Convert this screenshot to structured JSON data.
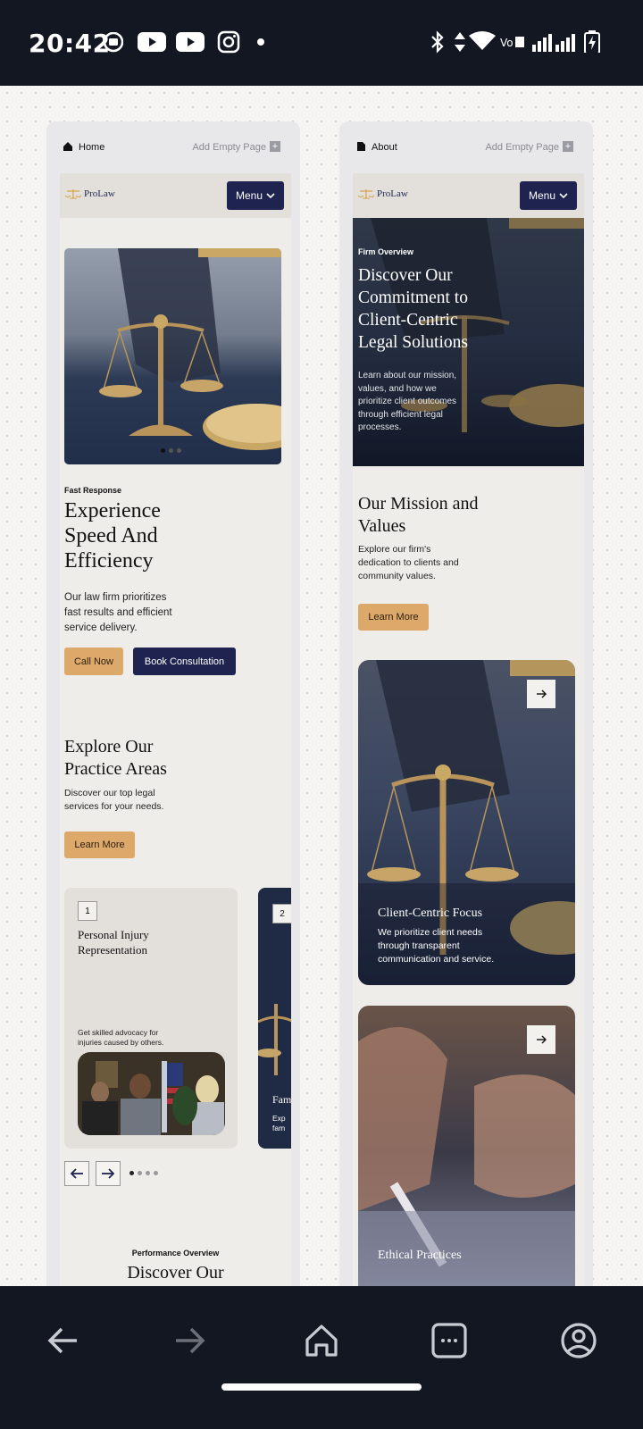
{
  "status_bar": {
    "time": "20:42"
  },
  "frames": [
    {
      "page_label": "Home",
      "add_page": "Add Empty Page",
      "header": {
        "logo": "ProLaw",
        "menu": "Menu"
      },
      "hero": {
        "eyebrow": "Fast Response",
        "title_lines": [
          "Experience",
          "Speed And",
          "Efficiency"
        ],
        "description_lines": [
          "Our law firm prioritizes",
          "fast results and efficient",
          "service delivery."
        ],
        "buttons": [
          "Call Now",
          "Book Consultation"
        ]
      },
      "practice": {
        "title_lines": [
          "Explore Our",
          "Practice Areas"
        ],
        "description_lines": [
          "Discover our top legal",
          "services for your needs."
        ],
        "button": "Learn More",
        "cards": [
          {
            "number": "1",
            "title_lines": [
              "Personal Injury",
              "Representation"
            ],
            "description_lines": [
              "Get skilled advocacy for",
              "injuries caused by others."
            ]
          },
          {
            "number": "2",
            "title_lines": [
              "Fam"
            ],
            "description_lines": [
              "Exp",
              "fam"
            ]
          }
        ]
      },
      "performance": {
        "eyebrow": "Performance Overview",
        "title_partial": "Discover Our"
      }
    },
    {
      "page_label": "About",
      "add_page": "Add Empty Page",
      "header": {
        "logo": "ProLaw",
        "menu": "Menu"
      },
      "hero": {
        "eyebrow": "Firm Overview",
        "title_lines": [
          "Discover Our",
          "Commitment to",
          "Client-Centric",
          "Legal Solutions"
        ],
        "description_lines": [
          "Learn about our mission,",
          "values, and how we",
          "prioritize client outcomes",
          "through efficient legal",
          "processes."
        ]
      },
      "mission": {
        "title_lines": [
          "Our Mission and",
          "Values"
        ],
        "description_lines": [
          "Explore our firm's",
          "dedication to clients and",
          "community values."
        ],
        "button": "Learn More"
      },
      "cards": [
        {
          "title": "Client-Centric Focus",
          "description_lines": [
            "We prioritize client needs",
            "through transparent",
            "communication and service."
          ]
        },
        {
          "title": "Ethical Practices"
        }
      ]
    }
  ],
  "colors": {
    "navy": "#1e2350",
    "gold": "#dda96a",
    "page_bg": "#efedea",
    "system_bar": "#121722"
  },
  "icons": [
    "home-icon",
    "page-icon",
    "back-icon",
    "forward-icon",
    "home-nav-icon",
    "tabs-icon",
    "account-icon"
  ]
}
